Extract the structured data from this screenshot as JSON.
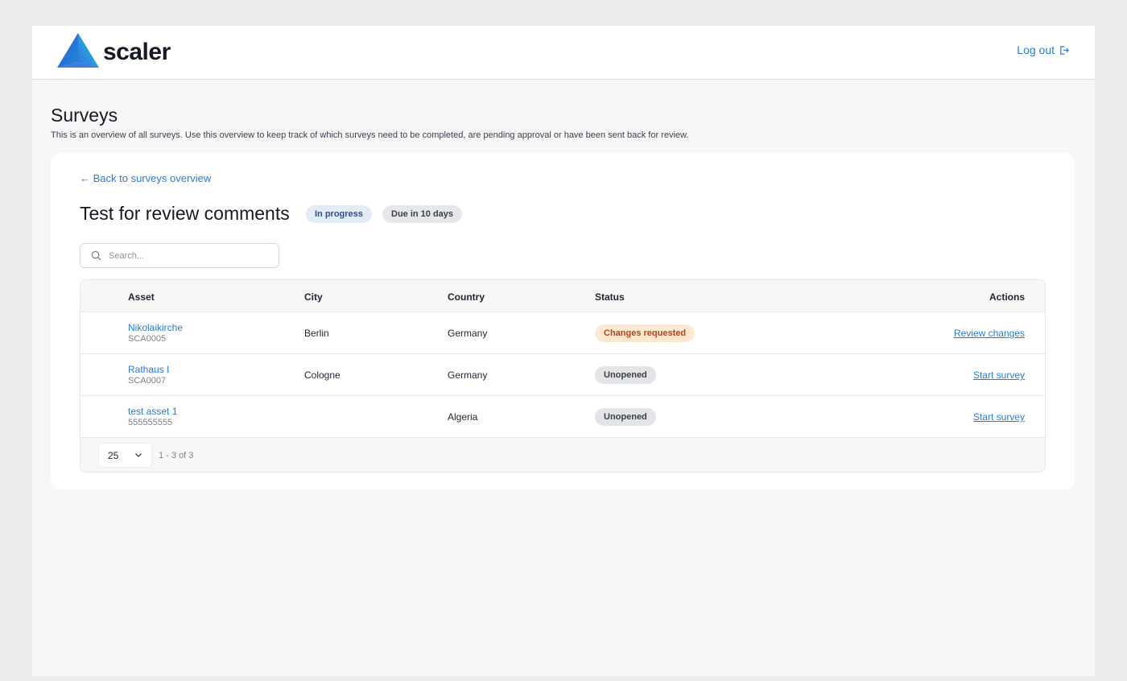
{
  "header": {
    "brand": "scaler",
    "logout_label": "Log out",
    "logo_icon": "scaler-triangle-logo",
    "logout_icon": "logout-icon"
  },
  "page": {
    "title": "Surveys",
    "description": "This is an overview of all surveys. Use this overview to keep track of which surveys need to be completed, are pending approval or have been sent back for review."
  },
  "card": {
    "back_label": "← Back to surveys overview",
    "survey_title": "Test for review comments",
    "status_badge": "In progress",
    "due_badge": "Due in 10 days",
    "search": {
      "placeholder": "Search...",
      "value": ""
    }
  },
  "table": {
    "columns": {
      "asset": "Asset",
      "city": "City",
      "country": "Country",
      "status": "Status",
      "actions": "Actions"
    },
    "rows": [
      {
        "asset_name": "Nikolaikirche",
        "asset_code": "SCA0005",
        "city": "Berlin",
        "country": "Germany",
        "status": "Changes requested",
        "action": "Review changes"
      },
      {
        "asset_name": "Rathaus I",
        "asset_code": "SCA0007",
        "city": "Cologne",
        "country": "Germany",
        "status": "Unopened",
        "action": "Start survey"
      },
      {
        "asset_name": "test asset 1",
        "asset_code": "555555555",
        "city": "",
        "country": "Algeria",
        "status": "Unopened",
        "action": "Start survey"
      }
    ],
    "pagination": {
      "per_page": "25",
      "range": "1 - 3 of 3"
    }
  },
  "colors": {
    "accent": "#2b7bd6",
    "status_changes_bg": "#fde8d2",
    "status_changes_text": "#b4451b",
    "status_unopened_bg": "#e3e4e7"
  }
}
